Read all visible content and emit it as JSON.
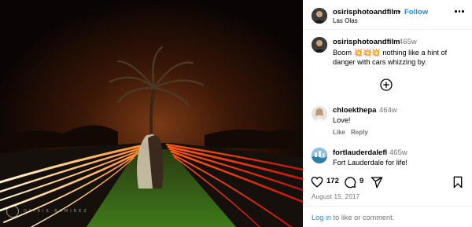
{
  "post": {
    "username": "osirisphotoandfilm",
    "separator": "•",
    "follow_label": "Follow",
    "location": "Las Olas",
    "photo_alt": "Couple embracing beneath a palm tree at night with light trails from passing cars"
  },
  "caption": {
    "username": "osirisphotoandfilm",
    "time": "465w",
    "text": "Boom 💥💥💥 nothing like a hint of danger with cars whizzing by."
  },
  "watermark": {
    "text": "OSIRIS RAMIREZ"
  },
  "comments": [
    {
      "username": "chloekthepa",
      "time": "464w",
      "text": "Love!",
      "like_label": "Like",
      "reply_label": "Reply"
    },
    {
      "username": "fortlauderdalefl",
      "time": "465w",
      "text": "Fort Lauderdale for life!"
    }
  ],
  "actions": {
    "likes": "172",
    "comments": "9",
    "date": "August 15, 2017"
  },
  "footer": {
    "login_link": "Log in",
    "login_rest": " to like or comment."
  },
  "colors": {
    "accent": "#0095f6",
    "secondary_text": "#737373"
  },
  "icons": [
    "more-options-icon",
    "load-more-comments-icon",
    "heart-icon",
    "comment-icon",
    "share-icon",
    "save-bookmark-icon"
  ]
}
